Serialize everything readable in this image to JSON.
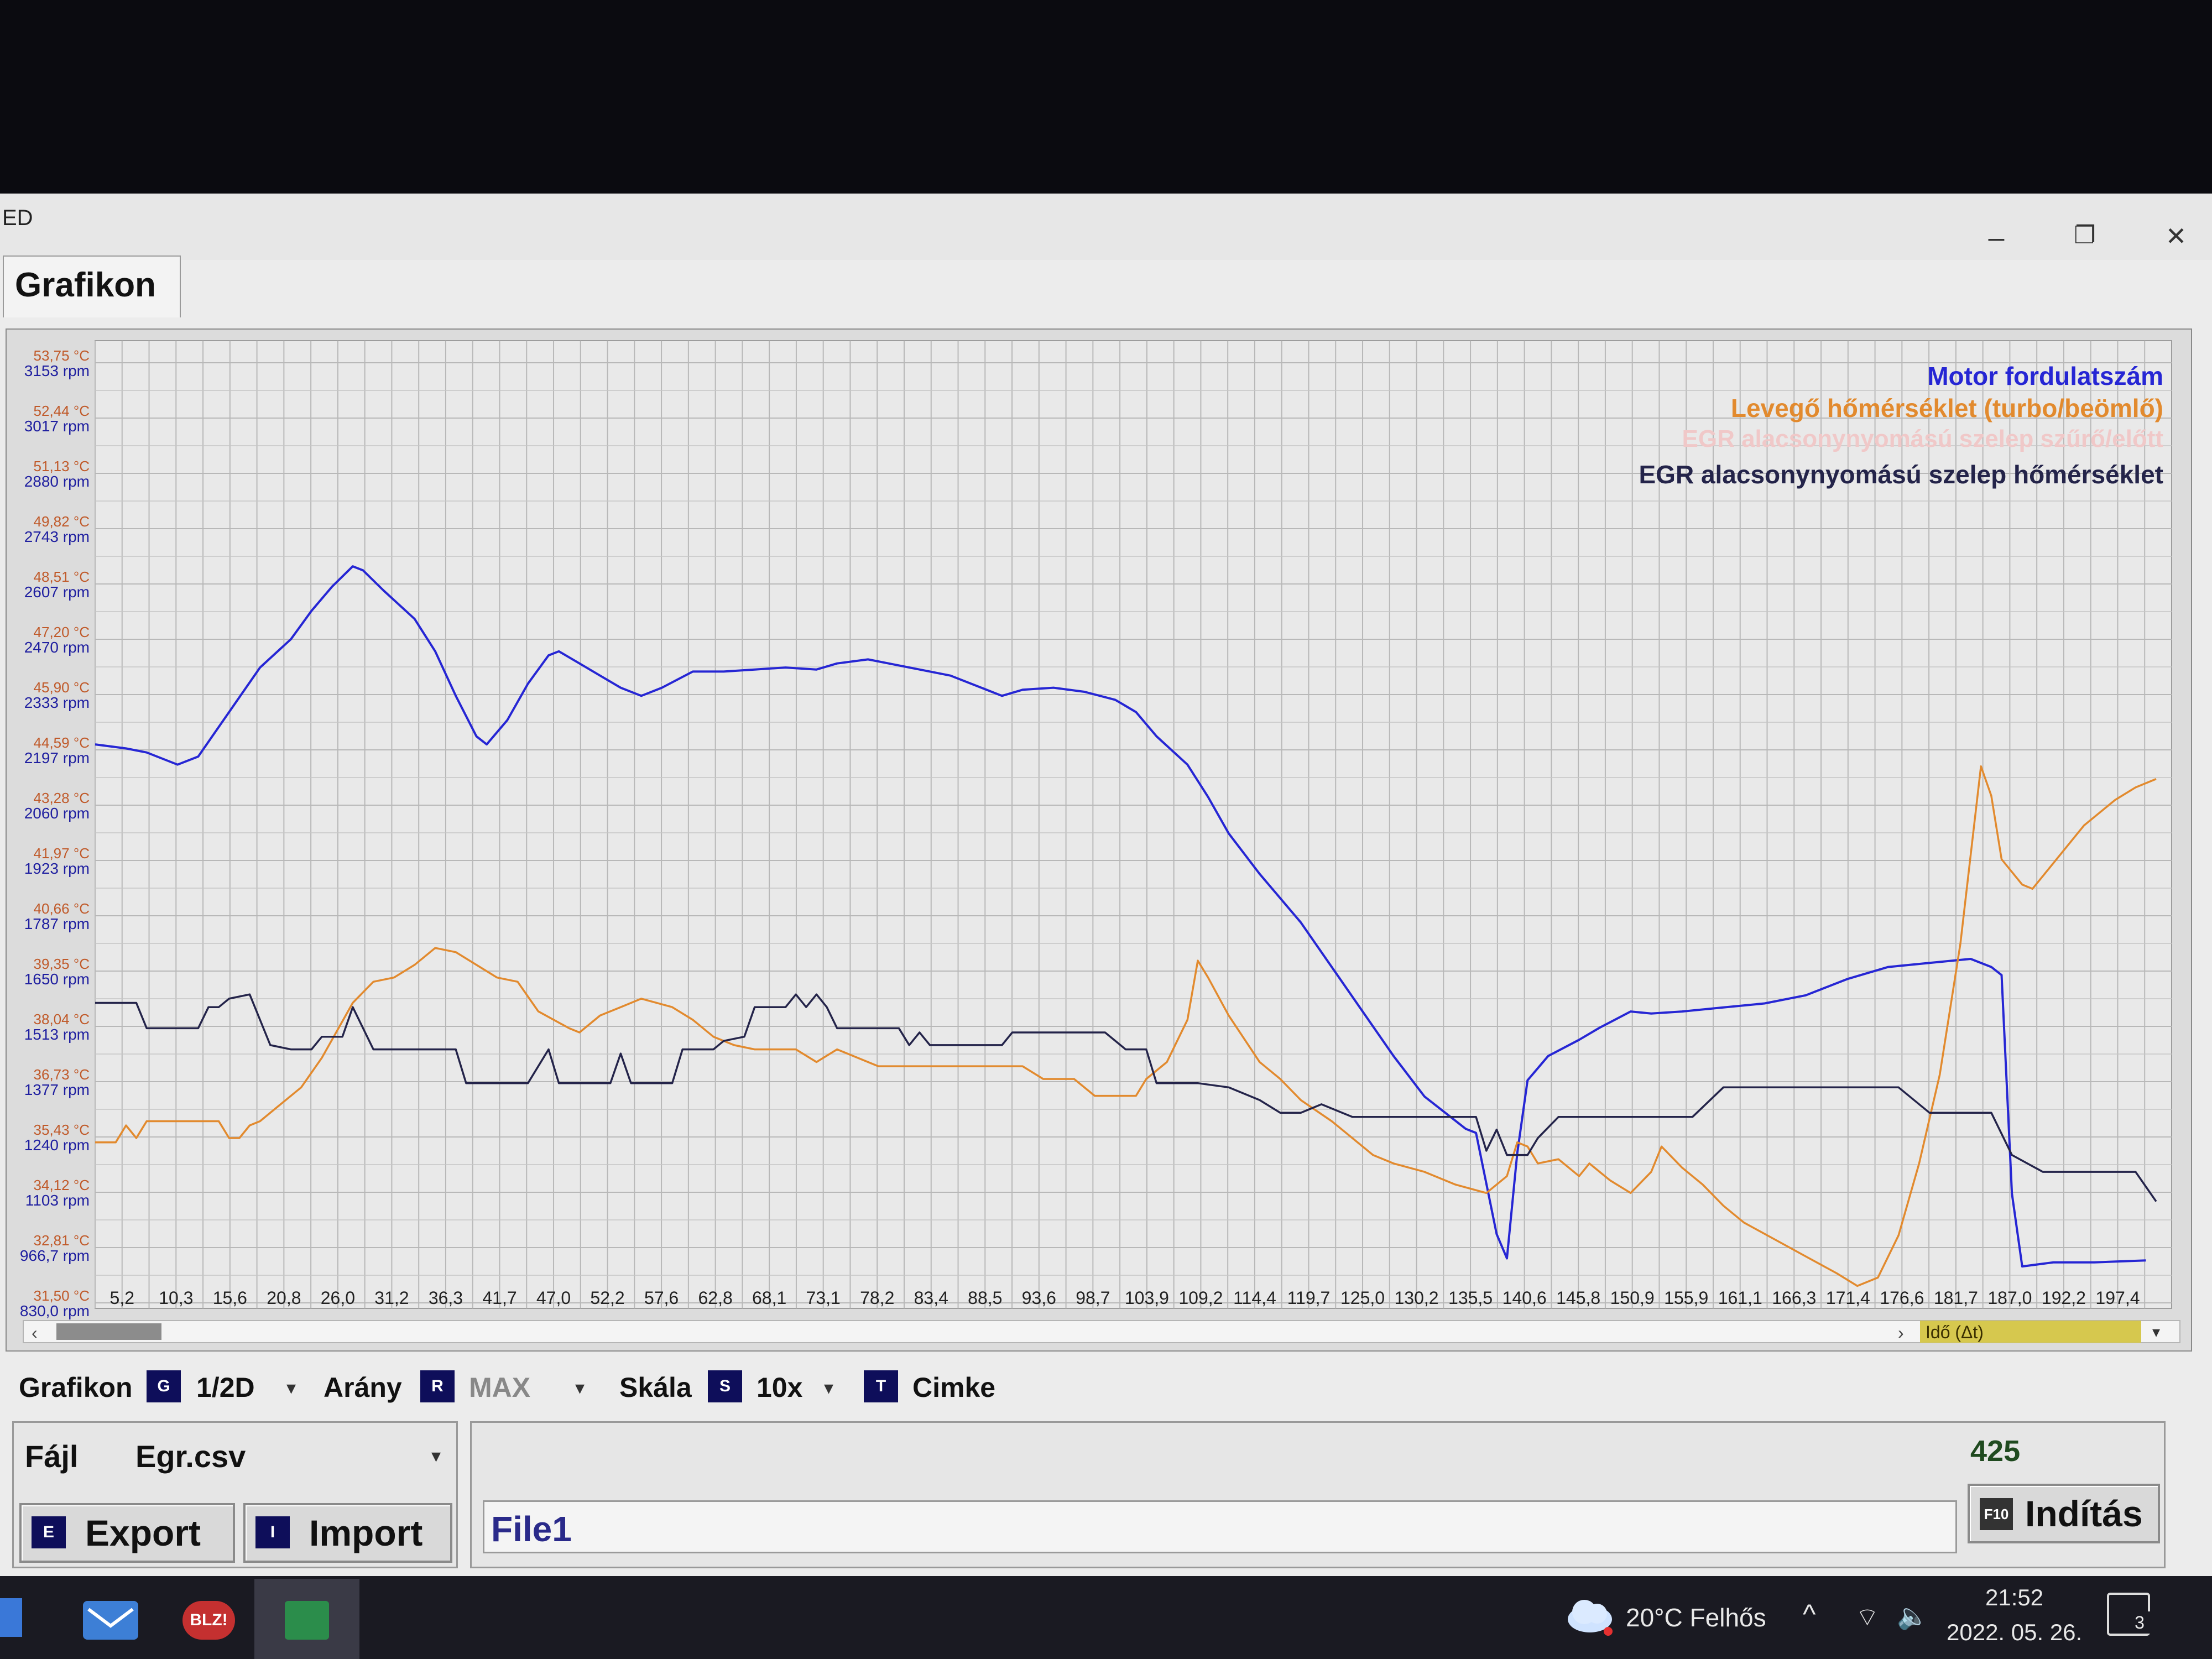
{
  "window": {
    "title": "ED",
    "tab_label": "Grafikon",
    "controls": {
      "minimize": "–",
      "restore": "❐",
      "close": "✕"
    }
  },
  "chart_data": {
    "type": "line",
    "x_label": "Idő (Δt)",
    "x_ticks": [
      "5,2",
      "10,3",
      "15,6",
      "20,8",
      "26,0",
      "31,2",
      "36,3",
      "41,7",
      "47,0",
      "52,2",
      "57,6",
      "62,8",
      "68,1",
      "73,1",
      "78,2",
      "83,4",
      "88,5",
      "93,6",
      "98,7",
      "103,9",
      "109,2",
      "114,4",
      "119,7",
      "125,0",
      "130,2",
      "135,5",
      "140,6",
      "145,8",
      "150,9",
      "155,9",
      "161,1",
      "166,3",
      "171,4",
      "176,6",
      "181,7",
      "187,0",
      "192,2",
      "197,4"
    ],
    "x_range": [
      0,
      201.5
    ],
    "y_ticks_temp": [
      "53,75 °C",
      "52,44 °C",
      "51,13 °C",
      "49,82 °C",
      "48,51 °C",
      "47,20 °C",
      "45,90 °C",
      "44,59 °C",
      "43,28 °C",
      "41,97 °C",
      "40,66 °C",
      "39,35 °C",
      "38,04 °C",
      "36,73 °C",
      "35,43 °C",
      "34,12 °C",
      "32,81 °C",
      "31,50 °C"
    ],
    "y_ticks_rpm": [
      "3153 rpm",
      "3017 rpm",
      "2880 rpm",
      "2743 rpm",
      "2607 rpm",
      "2470 rpm",
      "2333 rpm",
      "2197 rpm",
      "2060 rpm",
      "1923 rpm",
      "1787 rpm",
      "1650 rpm",
      "1513 rpm",
      "1377 rpm",
      "1240 rpm",
      "1103 rpm",
      "966,7 rpm",
      "830,0 rpm"
    ],
    "y_range_rpm": [
      830,
      3153
    ],
    "y_range_temp": [
      31.5,
      53.75
    ],
    "grid": true,
    "legend_position": "top-right",
    "series": [
      {
        "name": "Motor fordulatszám",
        "color": "#2626d4",
        "unit": "rpm",
        "points": [
          [
            0,
            2210
          ],
          [
            3,
            2200
          ],
          [
            5,
            2190
          ],
          [
            8,
            2160
          ],
          [
            10,
            2180
          ],
          [
            13,
            2290
          ],
          [
            16,
            2400
          ],
          [
            19,
            2470
          ],
          [
            21,
            2540
          ],
          [
            23,
            2600
          ],
          [
            25,
            2650
          ],
          [
            26,
            2640
          ],
          [
            28,
            2590
          ],
          [
            31,
            2520
          ],
          [
            33,
            2440
          ],
          [
            35,
            2330
          ],
          [
            37,
            2230
          ],
          [
            38,
            2210
          ],
          [
            40,
            2270
          ],
          [
            42,
            2360
          ],
          [
            44,
            2430
          ],
          [
            45,
            2440
          ],
          [
            47,
            2410
          ],
          [
            49,
            2380
          ],
          [
            51,
            2350
          ],
          [
            53,
            2330
          ],
          [
            55,
            2350
          ],
          [
            58,
            2390
          ],
          [
            61,
            2390
          ],
          [
            64,
            2395
          ],
          [
            67,
            2400
          ],
          [
            70,
            2395
          ],
          [
            72,
            2410
          ],
          [
            75,
            2420
          ],
          [
            77,
            2410
          ],
          [
            80,
            2395
          ],
          [
            83,
            2380
          ],
          [
            86,
            2350
          ],
          [
            88,
            2330
          ],
          [
            90,
            2345
          ],
          [
            93,
            2350
          ],
          [
            96,
            2340
          ],
          [
            99,
            2320
          ],
          [
            101,
            2290
          ],
          [
            103,
            2230
          ],
          [
            106,
            2160
          ],
          [
            108,
            2080
          ],
          [
            110,
            1990
          ],
          [
            113,
            1890
          ],
          [
            117,
            1770
          ],
          [
            120,
            1660
          ],
          [
            123,
            1550
          ],
          [
            126,
            1440
          ],
          [
            129,
            1340
          ],
          [
            132,
            1280
          ],
          [
            133,
            1260
          ],
          [
            134,
            1250
          ],
          [
            136,
            1000
          ],
          [
            137,
            940
          ],
          [
            138,
            1200
          ],
          [
            139,
            1380
          ],
          [
            141,
            1440
          ],
          [
            144,
            1480
          ],
          [
            146,
            1510
          ],
          [
            149,
            1550
          ],
          [
            151,
            1545
          ],
          [
            154,
            1550
          ],
          [
            158,
            1560
          ],
          [
            162,
            1570
          ],
          [
            166,
            1590
          ],
          [
            170,
            1630
          ],
          [
            174,
            1660
          ],
          [
            178,
            1670
          ],
          [
            182,
            1680
          ],
          [
            184,
            1660
          ],
          [
            185,
            1640
          ],
          [
            186,
            1100
          ],
          [
            187,
            920
          ],
          [
            190,
            930
          ],
          [
            194,
            930
          ],
          [
            199,
            935
          ]
        ]
      },
      {
        "name": "Levegő hőmérséklet (turbo/beömlő)",
        "color": "#e28a2e",
        "unit": "°C",
        "points": [
          [
            0,
            35.3
          ],
          [
            2,
            35.3
          ],
          [
            3,
            35.7
          ],
          [
            4,
            35.4
          ],
          [
            5,
            35.8
          ],
          [
            12,
            35.8
          ],
          [
            13,
            35.4
          ],
          [
            14,
            35.4
          ],
          [
            15,
            35.7
          ],
          [
            16,
            35.8
          ],
          [
            18,
            36.2
          ],
          [
            20,
            36.6
          ],
          [
            22,
            37.3
          ],
          [
            25,
            38.6
          ],
          [
            27,
            39.1
          ],
          [
            29,
            39.2
          ],
          [
            31,
            39.5
          ],
          [
            33,
            39.9
          ],
          [
            35,
            39.8
          ],
          [
            37,
            39.5
          ],
          [
            39,
            39.2
          ],
          [
            41,
            39.1
          ],
          [
            43,
            38.4
          ],
          [
            46,
            38.0
          ],
          [
            47,
            37.9
          ],
          [
            49,
            38.3
          ],
          [
            51,
            38.5
          ],
          [
            53,
            38.7
          ],
          [
            56,
            38.5
          ],
          [
            58,
            38.2
          ],
          [
            60,
            37.8
          ],
          [
            62,
            37.6
          ],
          [
            64,
            37.5
          ],
          [
            68,
            37.5
          ],
          [
            70,
            37.2
          ],
          [
            72,
            37.5
          ],
          [
            74,
            37.3
          ],
          [
            76,
            37.1
          ],
          [
            80,
            37.1
          ],
          [
            90,
            37.1
          ],
          [
            92,
            36.8
          ],
          [
            95,
            36.8
          ],
          [
            97,
            36.4
          ],
          [
            101,
            36.4
          ],
          [
            102,
            36.8
          ],
          [
            104,
            37.2
          ],
          [
            106,
            38.2
          ],
          [
            107,
            39.6
          ],
          [
            108,
            39.2
          ],
          [
            110,
            38.3
          ],
          [
            113,
            37.2
          ],
          [
            115,
            36.8
          ],
          [
            117,
            36.3
          ],
          [
            120,
            35.8
          ],
          [
            122,
            35.4
          ],
          [
            124,
            35.0
          ],
          [
            126,
            34.8
          ],
          [
            129,
            34.6
          ],
          [
            132,
            34.3
          ],
          [
            135,
            34.1
          ],
          [
            137,
            34.5
          ],
          [
            138,
            35.3
          ],
          [
            139,
            35.2
          ],
          [
            140,
            34.8
          ],
          [
            142,
            34.9
          ],
          [
            144,
            34.5
          ],
          [
            145,
            34.8
          ],
          [
            147,
            34.4
          ],
          [
            149,
            34.1
          ],
          [
            151,
            34.6
          ],
          [
            152,
            35.2
          ],
          [
            154,
            34.7
          ],
          [
            156,
            34.3
          ],
          [
            158,
            33.8
          ],
          [
            160,
            33.4
          ],
          [
            163,
            33.0
          ],
          [
            166,
            32.6
          ],
          [
            169,
            32.2
          ],
          [
            171,
            31.9
          ],
          [
            173,
            32.1
          ],
          [
            175,
            33.1
          ],
          [
            177,
            34.8
          ],
          [
            179,
            36.9
          ],
          [
            181,
            40.0
          ],
          [
            183,
            44.2
          ],
          [
            184,
            43.5
          ],
          [
            185,
            42.0
          ],
          [
            187,
            41.4
          ],
          [
            188,
            41.3
          ],
          [
            190,
            41.9
          ],
          [
            193,
            42.8
          ],
          [
            196,
            43.4
          ],
          [
            198,
            43.7
          ],
          [
            200,
            43.9
          ]
        ]
      },
      {
        "name": "EGR alacsonynyomású szelep hőmérséklet",
        "color": "#24244a",
        "unit": "°C",
        "points": [
          [
            0,
            38.6
          ],
          [
            4,
            38.6
          ],
          [
            5,
            38.0
          ],
          [
            8,
            38.0
          ],
          [
            10,
            38.0
          ],
          [
            11,
            38.5
          ],
          [
            12,
            38.5
          ],
          [
            13,
            38.7
          ],
          [
            15,
            38.8
          ],
          [
            16,
            38.2
          ],
          [
            17,
            37.6
          ],
          [
            19,
            37.5
          ],
          [
            21,
            37.5
          ],
          [
            22,
            37.8
          ],
          [
            24,
            37.8
          ],
          [
            25,
            38.5
          ],
          [
            27,
            37.5
          ],
          [
            30,
            37.5
          ],
          [
            35,
            37.5
          ],
          [
            36,
            36.7
          ],
          [
            42,
            36.7
          ],
          [
            44,
            37.5
          ],
          [
            45,
            36.7
          ],
          [
            50,
            36.7
          ],
          [
            51,
            37.4
          ],
          [
            52,
            36.7
          ],
          [
            56,
            36.7
          ],
          [
            57,
            37.5
          ],
          [
            60,
            37.5
          ],
          [
            61,
            37.7
          ],
          [
            63,
            37.8
          ],
          [
            64,
            38.5
          ],
          [
            67,
            38.5
          ],
          [
            68,
            38.8
          ],
          [
            69,
            38.5
          ],
          [
            70,
            38.8
          ],
          [
            71,
            38.5
          ],
          [
            72,
            38.0
          ],
          [
            78,
            38.0
          ],
          [
            79,
            37.6
          ],
          [
            80,
            37.9
          ],
          [
            81,
            37.6
          ],
          [
            84,
            37.6
          ],
          [
            88,
            37.6
          ],
          [
            89,
            37.9
          ],
          [
            93,
            37.9
          ],
          [
            98,
            37.9
          ],
          [
            100,
            37.5
          ],
          [
            102,
            37.5
          ],
          [
            103,
            36.7
          ],
          [
            107,
            36.7
          ],
          [
            110,
            36.6
          ],
          [
            113,
            36.3
          ],
          [
            115,
            36.0
          ],
          [
            117,
            36.0
          ],
          [
            119,
            36.2
          ],
          [
            122,
            35.9
          ],
          [
            126,
            35.9
          ],
          [
            128,
            35.9
          ],
          [
            131,
            35.9
          ],
          [
            134,
            35.9
          ],
          [
            135,
            35.1
          ],
          [
            136,
            35.6
          ],
          [
            137,
            35.0
          ],
          [
            139,
            35.0
          ],
          [
            140,
            35.4
          ],
          [
            142,
            35.9
          ],
          [
            147,
            35.9
          ],
          [
            150,
            35.9
          ],
          [
            155,
            35.9
          ],
          [
            158,
            36.6
          ],
          [
            165,
            36.6
          ],
          [
            170,
            36.6
          ],
          [
            175,
            36.6
          ],
          [
            178,
            36.0
          ],
          [
            182,
            36.0
          ],
          [
            184,
            36.0
          ],
          [
            186,
            35.0
          ],
          [
            189,
            34.6
          ],
          [
            193,
            34.6
          ],
          [
            196,
            34.6
          ],
          [
            198,
            34.6
          ],
          [
            200,
            33.9
          ]
        ]
      }
    ],
    "legend_hidden_entry": "EGR alacsonynyomású szelep szűrő/előtt"
  },
  "controls": {
    "grafikon_label": "Grafikon",
    "grafikon_key": "G",
    "grafikon_value": "1/2D",
    "arany_label": "Arány",
    "arany_key": "R",
    "arany_value": "MAX",
    "skala_label": "Skála",
    "skala_key": "S",
    "skala_value": "10x",
    "cimke_key": "T",
    "cimke_label": "Cimke",
    "fajl_label": "Fájl",
    "fajl_value": "Egr.csv",
    "export_key": "E",
    "export_label": "Export",
    "import_key": "I",
    "import_label": "Import",
    "file_name": "File1",
    "counter": "425",
    "start_key": "F10",
    "start_label": "Indítás",
    "dropdown_arrow": "▾"
  },
  "taskbar": {
    "weather": "20°C  Felhős",
    "time": "21:52",
    "date": "2022. 05. 26.",
    "notifications": "3",
    "app_label": "BLZ!"
  }
}
